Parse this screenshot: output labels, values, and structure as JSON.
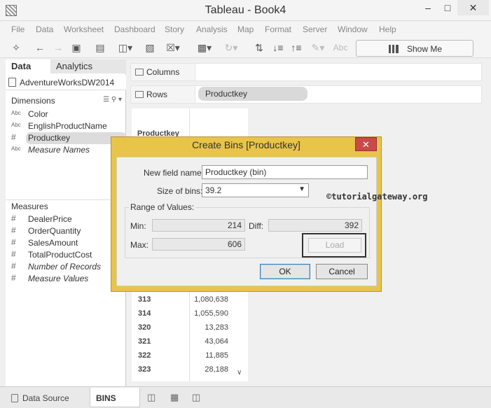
{
  "window": {
    "title": "Tableau - Book4"
  },
  "menu": [
    "File",
    "Data",
    "Worksheet",
    "Dashboard",
    "Story",
    "Analysis",
    "Map",
    "Format",
    "Server",
    "Window",
    "Help"
  ],
  "toolbar": {
    "text_tool": "Abc",
    "show_me": "Show Me"
  },
  "left_panel": {
    "tabs": {
      "data": "Data",
      "analytics": "Analytics"
    },
    "datasource": "AdventureWorksDW2014",
    "dimensions_header": "Dimensions",
    "dimensions": [
      {
        "type": "Abc",
        "name": "Color"
      },
      {
        "type": "Abc",
        "name": "EnglishProductName"
      },
      {
        "type": "#",
        "name": "Productkey"
      },
      {
        "type": "Abc",
        "name": "Measure Names"
      }
    ],
    "measures_header": "Measures",
    "measures": [
      {
        "type": "#",
        "name": "DealerPrice"
      },
      {
        "type": "#",
        "name": "OrderQuantity"
      },
      {
        "type": "#",
        "name": "SalesAmount"
      },
      {
        "type": "#",
        "name": "TotalProductCost"
      },
      {
        "type": "#",
        "name": "Number of Records"
      },
      {
        "type": "#",
        "name": "Measure Values"
      }
    ]
  },
  "shelves": {
    "columns": "Columns",
    "rows": "Rows",
    "rows_pill": "Productkey"
  },
  "viz": {
    "column_header": "Productkey",
    "rows": [
      {
        "key": "313",
        "value": "1,080,638"
      },
      {
        "key": "314",
        "value": "1,055,590"
      },
      {
        "key": "320",
        "value": "13,283"
      },
      {
        "key": "321",
        "value": "43,064"
      },
      {
        "key": "322",
        "value": "11,885"
      },
      {
        "key": "323",
        "value": "28,188"
      }
    ]
  },
  "dialog": {
    "title": "Create Bins [Productkey]",
    "new_field_label": "New field name:",
    "new_field_value": "Productkey (bin)",
    "size_label": "Size of bins:",
    "size_value": "39.2",
    "range_title": "Range of Values:",
    "min_label": "Min:",
    "min_value": "214",
    "diff_label": "Diff:",
    "diff_value": "392",
    "max_label": "Max:",
    "max_value": "606",
    "load_label": "Load",
    "ok_label": "OK",
    "cancel_label": "Cancel",
    "close_glyph": "✕"
  },
  "watermark": "©tutorialgateway.org",
  "bottom_tabs": {
    "datasource": "Data Source",
    "sheet": "BINS"
  }
}
